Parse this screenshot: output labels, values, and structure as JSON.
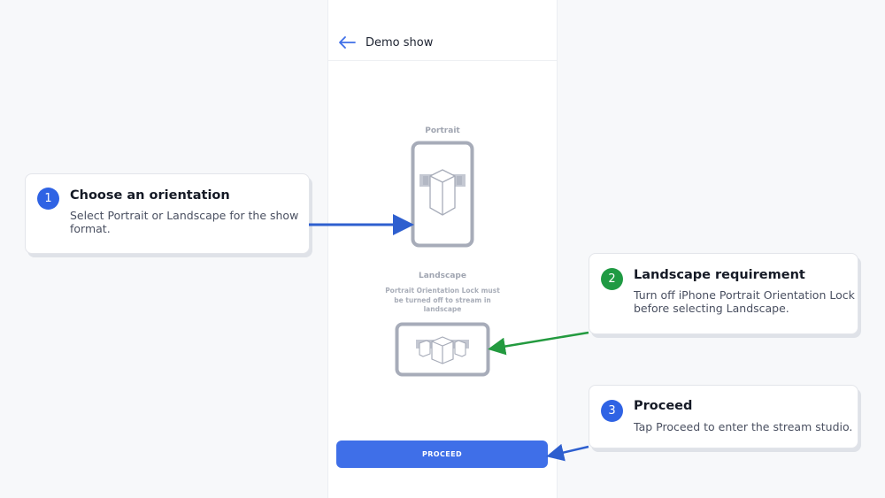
{
  "screen": {
    "title": "Demo show",
    "portrait_label": "Portrait",
    "landscape_label": "Landscape",
    "landscape_note": "Portrait Orientation Lock must be turned off to stream in landscape",
    "proceed_label": "PROCEED"
  },
  "callouts": [
    {
      "number": "1",
      "title": "Choose an orientation",
      "body": "Select Portrait or Landscape for the show format."
    },
    {
      "number": "2",
      "title": "Landscape requirement",
      "body": "Turn off iPhone Portrait Orientation Lock before selecting Landscape."
    },
    {
      "number": "3",
      "title": "Proceed",
      "body": "Tap Proceed to enter the stream studio."
    }
  ],
  "colors": {
    "accent": "#3f6fe8",
    "badge_blue": "#2f63e4",
    "badge_green": "#1f9a43",
    "arrow_blue": "#2e5fcf",
    "arrow_green": "#239a3f"
  },
  "icons": {
    "back": "arrow-left-icon",
    "portrait": "portrait-phone-icon",
    "landscape": "landscape-phone-icon"
  }
}
